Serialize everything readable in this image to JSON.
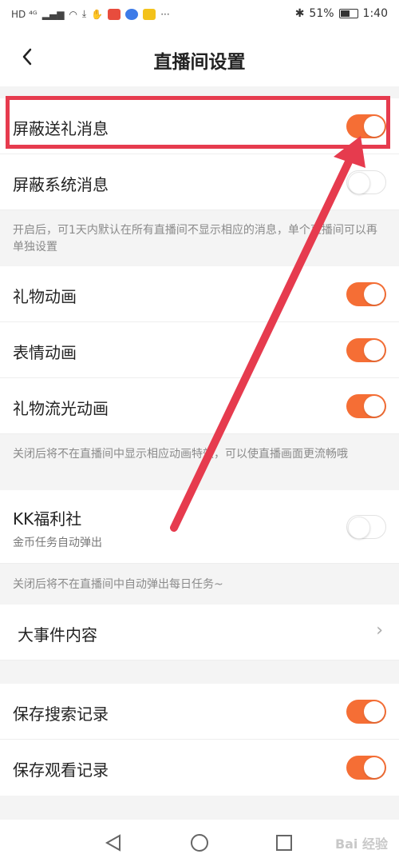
{
  "status": {
    "left_text": "HD ⁴ᴳ",
    "battery": "51%",
    "time": "1:40",
    "more": "···"
  },
  "header": {
    "title": "直播间设置"
  },
  "settings": {
    "block_gift": {
      "label": "屏蔽送礼消息",
      "on": true
    },
    "block_system": {
      "label": "屏蔽系统消息",
      "on": false
    },
    "note1": "开启后，可1天内默认在所有直播间不显示相应的消息，单个直播间可以再单独设置",
    "gift_anim": {
      "label": "礼物动画",
      "on": true
    },
    "emoji_anim": {
      "label": "表情动画",
      "on": true
    },
    "gift_flow_anim": {
      "label": "礼物流光动画",
      "on": true
    },
    "note2": "关闭后将不在直播间中显示相应动画特效，可以使直播画面更流畅哦",
    "kk_welfare": {
      "label": "KK福利社",
      "sub": "金币任务自动弹出",
      "on": false
    },
    "note3": "关闭后将不在直播间中自动弹出每日任务~",
    "big_event": {
      "label": "大事件内容"
    },
    "save_search": {
      "label": "保存搜索记录",
      "on": true
    },
    "save_watch": {
      "label": "保存观看记录",
      "on": true
    }
  },
  "colors": {
    "accent": "#f56e35",
    "annotation": "#e63b4e"
  },
  "watermark": "Bai 经验"
}
